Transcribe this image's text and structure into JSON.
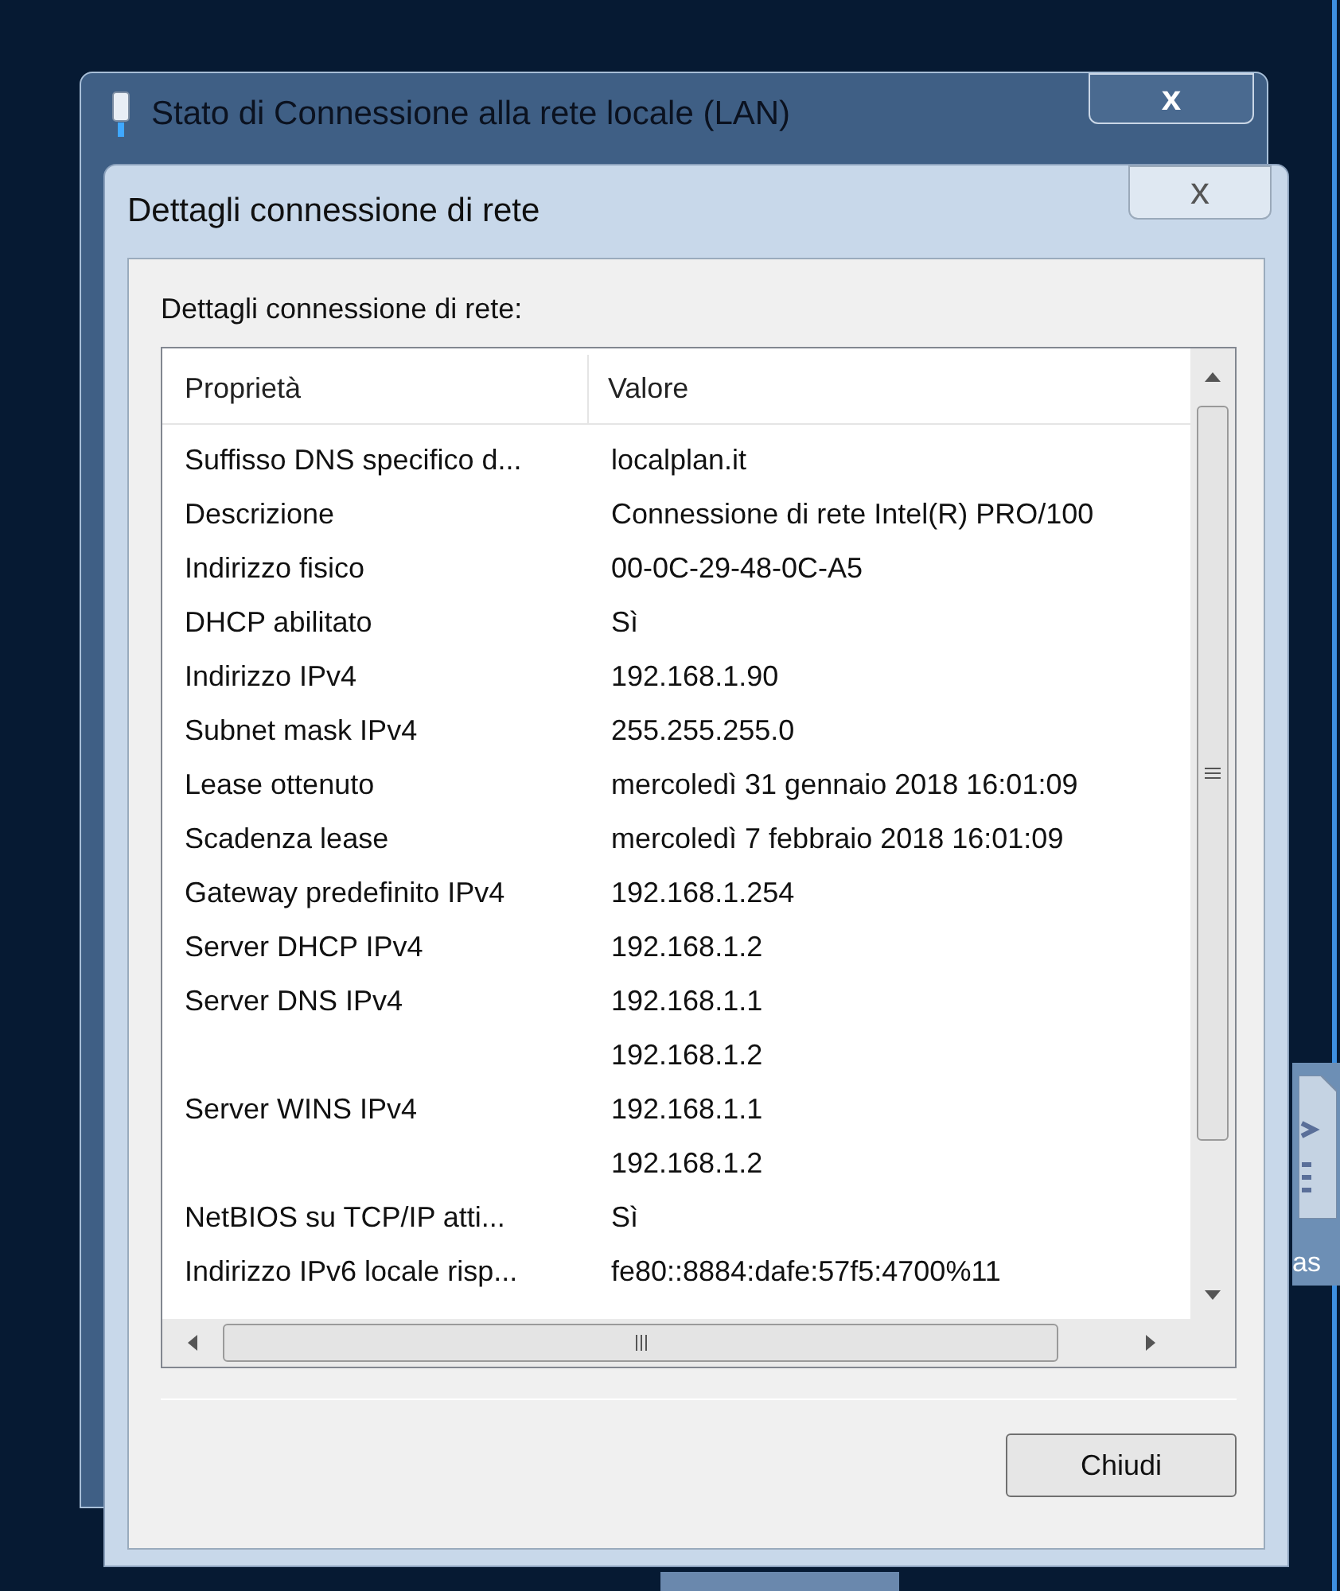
{
  "background_window": {
    "title": "Stato di Connessione alla rete locale (LAN)",
    "close": "x"
  },
  "desktop_icon": {
    "label": "as"
  },
  "dialog": {
    "title": "Dettagli connessione di rete",
    "close": "x",
    "group_label": "Dettagli connessione di rete:",
    "table": {
      "columns": [
        "Proprietà",
        "Valore"
      ],
      "rows": [
        {
          "property": "Suffisso DNS specifico d...",
          "value": "localplan.it"
        },
        {
          "property": "Descrizione",
          "value": "Connessione di rete Intel(R) PRO/100"
        },
        {
          "property": "Indirizzo fisico",
          "value": "00-0C-29-48-0C-A5"
        },
        {
          "property": "DHCP abilitato",
          "value": "Sì"
        },
        {
          "property": "Indirizzo IPv4",
          "value": "192.168.1.90"
        },
        {
          "property": "Subnet mask IPv4",
          "value": "255.255.255.0"
        },
        {
          "property": "Lease ottenuto",
          "value": "mercoledì 31 gennaio 2018 16:01:09"
        },
        {
          "property": "Scadenza lease",
          "value": "mercoledì 7 febbraio 2018 16:01:09"
        },
        {
          "property": "Gateway predefinito IPv4",
          "value": "192.168.1.254"
        },
        {
          "property": "Server DHCP IPv4",
          "value": "192.168.1.2"
        },
        {
          "property": "Server DNS IPv4",
          "value": "192.168.1.1"
        },
        {
          "property": "",
          "value": "192.168.1.2"
        },
        {
          "property": "Server WINS IPv4",
          "value": "192.168.1.1"
        },
        {
          "property": "",
          "value": "192.168.1.2"
        },
        {
          "property": "NetBIOS su TCP/IP atti...",
          "value": "Sì"
        },
        {
          "property": "Indirizzo IPv6 locale risp...",
          "value": "fe80::8884:dafe:57f5:4700%11"
        }
      ]
    },
    "button": "Chiudi"
  }
}
